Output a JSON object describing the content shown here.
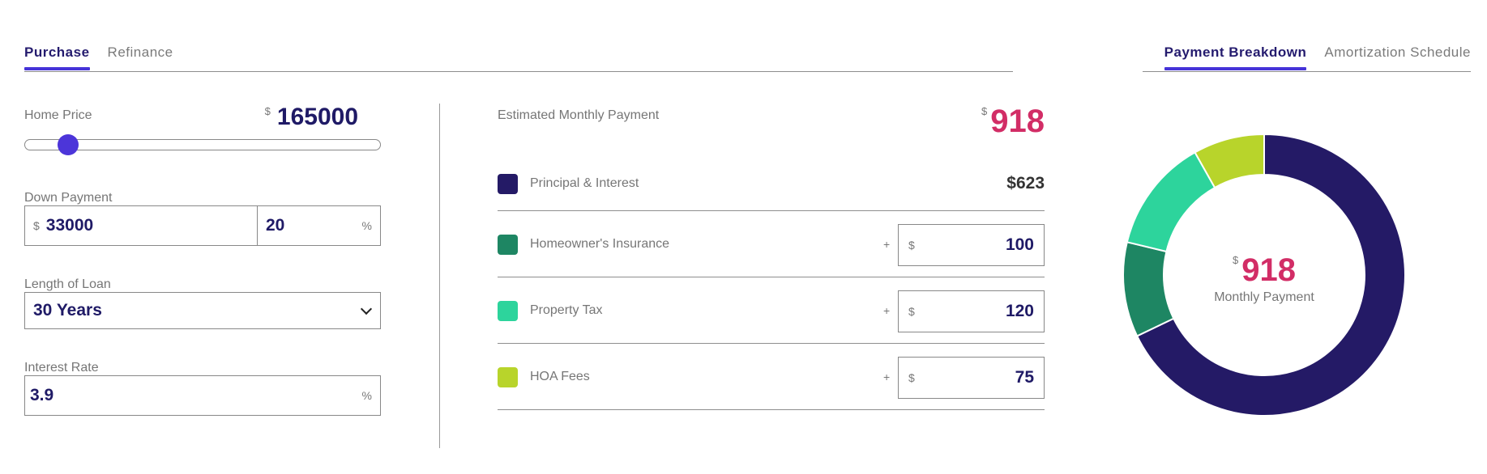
{
  "tabs_left": [
    {
      "label": "Purchase",
      "active": true
    },
    {
      "label": "Refinance",
      "active": false
    }
  ],
  "tabs_right": [
    {
      "label": "Payment Breakdown",
      "active": true
    },
    {
      "label": "Amortization Schedule",
      "active": false
    }
  ],
  "home_price": {
    "label": "Home Price",
    "currency": "$",
    "value": "165000",
    "slider_fraction": 0.1
  },
  "down_payment": {
    "label": "Down Payment",
    "currency": "$",
    "value": "33000",
    "percent": "20",
    "percent_symbol": "%"
  },
  "loan_length": {
    "label": "Length of Loan",
    "value": "30 Years"
  },
  "interest_rate": {
    "label": "Interest Rate",
    "value": "3.9",
    "percent_symbol": "%"
  },
  "summary": {
    "label": "Estimated Monthly Payment",
    "currency": "$",
    "value": "918"
  },
  "breakdown": [
    {
      "label": "Principal & Interest",
      "amount": "$623",
      "color": "#241a66"
    },
    {
      "label": "Homeowner's Insurance",
      "plus": "+",
      "currency": "$",
      "value": "100",
      "color": "#1e8663"
    },
    {
      "label": "Property Tax",
      "plus": "+",
      "currency": "$",
      "value": "120",
      "color": "#2dd49c"
    },
    {
      "label": "HOA Fees",
      "plus": "+",
      "currency": "$",
      "value": "75",
      "color": "#b8d42b"
    }
  ],
  "donut": {
    "currency": "$",
    "value": "918",
    "label": "Monthly Payment",
    "segments": [
      {
        "value": 623,
        "color": "#241a66"
      },
      {
        "value": 100,
        "color": "#1e8663"
      },
      {
        "value": 120,
        "color": "#2dd49c"
      },
      {
        "value": 75,
        "color": "#b8d42b"
      }
    ]
  }
}
